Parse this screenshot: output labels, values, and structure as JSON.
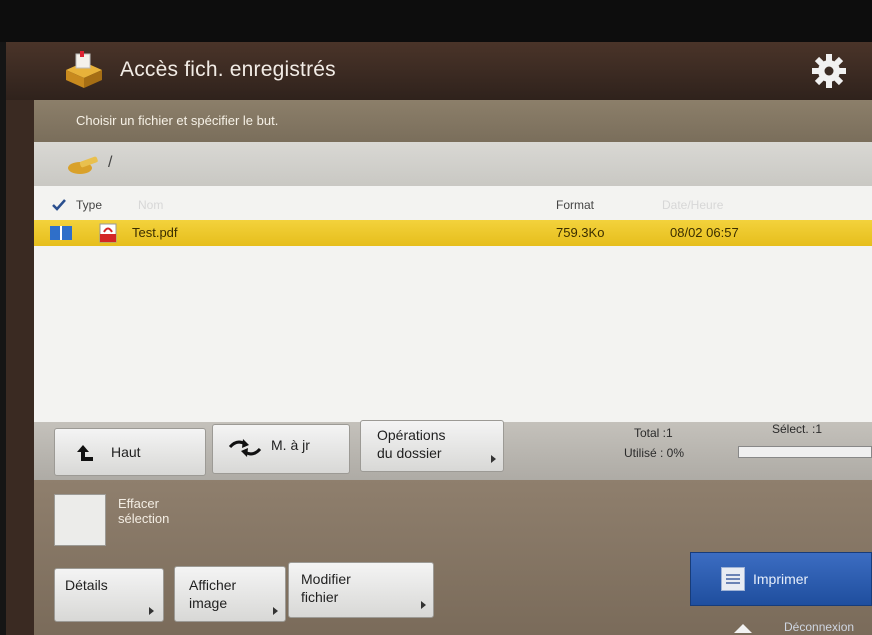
{
  "header": {
    "title": "Accès fich. enregistrés",
    "app_icon": "file-box-icon",
    "settings_icon": "gear-icon"
  },
  "instruction": "Choisir un fichier et spécifier le but.",
  "path": {
    "icon": "folder-key-icon",
    "text": "/"
  },
  "list": {
    "columns": {
      "type": "Type",
      "name": "Nom",
      "format": "Format",
      "date": "Date/Heure"
    },
    "rows": [
      {
        "name": "Test.pdf",
        "size": "759.3Ko",
        "date": "08/02  06:57",
        "selected": true
      }
    ]
  },
  "toolbar": {
    "up_label": "Haut",
    "refresh_label": "M. à jr",
    "folder_ops_line1": "Opérations",
    "folder_ops_line2": "du dossier",
    "total": "Total :1",
    "selected": "Sélect. :1",
    "used": "Utilisé : 0%"
  },
  "actions": {
    "clear_line1": "Effacer",
    "clear_line2": "sélection",
    "details": "Détails",
    "view_line1": "Afficher",
    "view_line2": "image",
    "edit_line1": "Modifier",
    "edit_line2": "fichier",
    "print": "Imprimer",
    "logout": "Déconnexion"
  },
  "colors": {
    "selection": "#e9c426",
    "print_button": "#2a5aab",
    "title_bar": "#3b2b23"
  }
}
